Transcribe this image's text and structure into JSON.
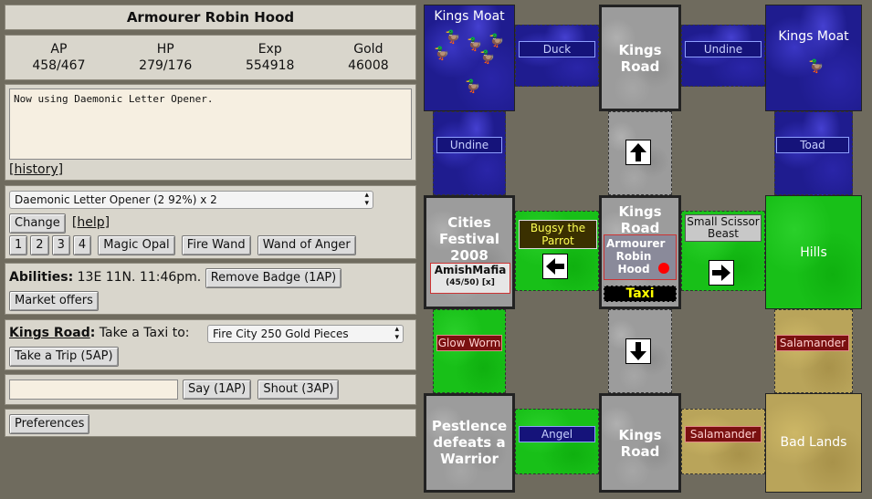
{
  "character": {
    "title": "Armourer Robin Hood"
  },
  "stats": [
    {
      "label": "AP",
      "value": "458/467"
    },
    {
      "label": "HP",
      "value": "279/176"
    },
    {
      "label": "Exp",
      "value": "554918"
    },
    {
      "label": "Gold",
      "value": "46008"
    }
  ],
  "log": {
    "text": "Now using Daemonic Letter Opener.",
    "history_link": "[history]"
  },
  "weapon": {
    "selected": "Daemonic Letter Opener (2 92%) x 2",
    "change": "Change",
    "help": "[help]",
    "slots": [
      "1",
      "2",
      "3",
      "4"
    ],
    "quick": [
      "Magic Opal",
      "Fire Wand",
      "Wand of Anger"
    ]
  },
  "abilities": {
    "label": "Abilities:",
    "text": "13E 11N. 11:46pm.",
    "remove_badge": "Remove Badge (1AP)",
    "market": "Market offers"
  },
  "taxi": {
    "location": "Kings Road",
    "prompt": "Take a Taxi to:",
    "selected": "Fire City 250 Gold Pieces",
    "trip": "Take a Trip (5AP)"
  },
  "chat": {
    "input": "",
    "say": "Say (1AP)",
    "shout": "Shout (3AP)"
  },
  "prefs": {
    "label": "Preferences"
  },
  "map": {
    "nw": "Kings Moat",
    "n": "Kings Road",
    "ne": "Kings Moat",
    "w": "Cities Festival 2008",
    "center": "Kings Road",
    "e": "Hills",
    "sw": "Pestlence defeats a Warrior",
    "s": "Kings Road",
    "se": "Bad Lands",
    "labels": {
      "duck": "Duck",
      "undine_top": "Undine",
      "undine_left": "Undine",
      "toad": "Toad",
      "bugsy": "Bugsy the Parrot",
      "scissor": "Small Scissor Beast",
      "glow_worm": "Glow Worm",
      "salamander_right": "Salamander",
      "angel": "Angel",
      "salamander_bottom": "Salamander"
    },
    "player": "Armourer Robin Hood",
    "taxi": "Taxi",
    "mafia": {
      "name": "AmishMafia",
      "hp": "(45/50) [x]"
    }
  },
  "icons": [
    "up-arrow-icon",
    "down-arrow-icon",
    "left-arrow-icon",
    "right-arrow-icon",
    "duck-icon",
    "player-dot-icon"
  ],
  "colors": {
    "water": "#1f1c8f",
    "grass": "#18c018",
    "road": "#9c9c9c",
    "sand": "#b9a45a",
    "player_dot": "#ff0000",
    "taxi_text": "#ffff00"
  }
}
